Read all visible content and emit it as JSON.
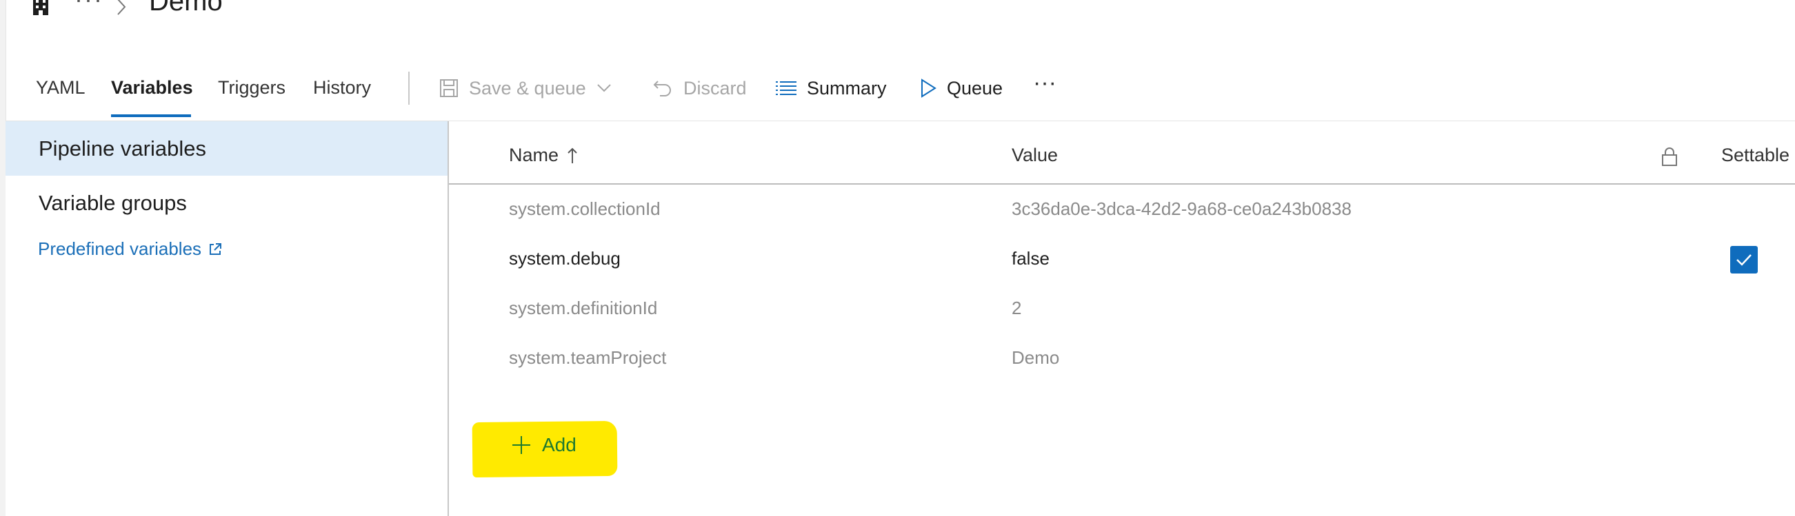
{
  "breadcrumb": {
    "ellipsis": "···",
    "title": "Demo"
  },
  "tabs": [
    {
      "label": "YAML"
    },
    {
      "label": "Variables"
    },
    {
      "label": "Triggers"
    },
    {
      "label": "History"
    }
  ],
  "toolbar": {
    "save_queue": "Save & queue",
    "discard": "Discard",
    "summary": "Summary",
    "queue": "Queue",
    "more": "···"
  },
  "sidebar": {
    "items": [
      {
        "label": "Pipeline variables",
        "selected": true
      },
      {
        "label": "Variable groups",
        "selected": false
      }
    ],
    "link": "Predefined variables"
  },
  "table": {
    "columns": {
      "name": "Name",
      "value": "Value",
      "settable": "Settable"
    },
    "rows": [
      {
        "name": "system.collectionId",
        "value": "3c36da0e-3dca-42d2-9a68-ce0a243b0838",
        "settable": false
      },
      {
        "name": "system.debug",
        "value": "false",
        "settable": true
      },
      {
        "name": "system.definitionId",
        "value": "2",
        "settable": false
      },
      {
        "name": "system.teamProject",
        "value": "Demo",
        "settable": false
      }
    ]
  },
  "add_button": "Add",
  "colors": {
    "accent": "#0f6cbd",
    "selected_bg": "#deecf9",
    "highlight": "#ffea00"
  }
}
